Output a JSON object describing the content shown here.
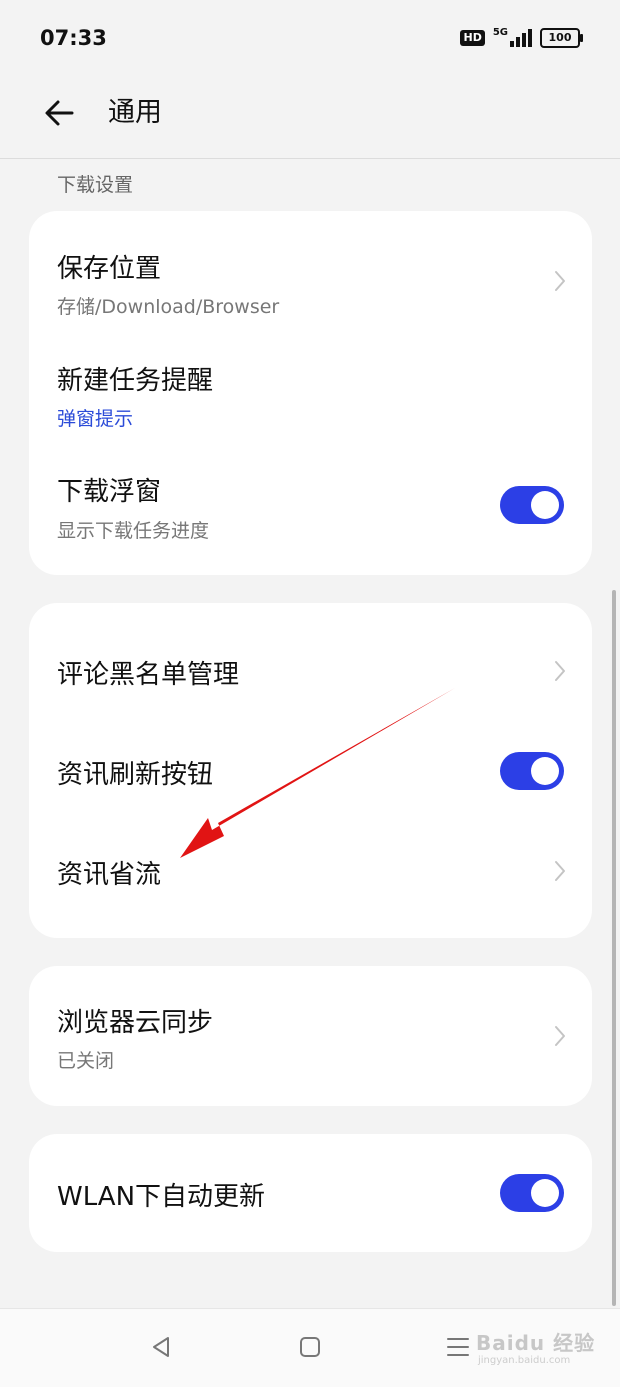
{
  "status_bar": {
    "time": "07:33",
    "hd_badge": "HD",
    "network": "5G",
    "battery": "100"
  },
  "header": {
    "back_icon": "arrow-left-icon",
    "title": "通用"
  },
  "download_section": {
    "label": "下载设置",
    "save_location": {
      "title": "保存位置",
      "subtitle": "存储/Download/Browser"
    },
    "new_task_reminder": {
      "title": "新建任务提醒",
      "subtitle": "弹窗提示"
    },
    "download_float": {
      "title": "下载浮窗",
      "subtitle": "显示下载任务进度",
      "enabled": true
    }
  },
  "news_section": {
    "comment_blacklist": {
      "title": "评论黑名单管理"
    },
    "news_refresh_button": {
      "title": "资讯刷新按钮",
      "enabled": true
    },
    "news_data_saver": {
      "title": "资讯省流"
    }
  },
  "sync_section": {
    "cloud_sync": {
      "title": "浏览器云同步",
      "subtitle": "已关闭"
    }
  },
  "wlan_section": {
    "auto_update": {
      "title": "WLAN下自动更新",
      "enabled": true
    }
  },
  "nav_bar": {
    "back_icon": "triangle-back-icon",
    "home_icon": "square-home-icon",
    "menu_icon": "hamburger-menu-icon"
  },
  "watermark": {
    "brand": "Baidu 经验",
    "url": "jingyan.baidu.com"
  },
  "colors": {
    "accent": "#2c3fe6",
    "subtitle_accent": "#2b4bd8",
    "annotation_arrow": "#e11414",
    "background": "#f3f3f3"
  }
}
